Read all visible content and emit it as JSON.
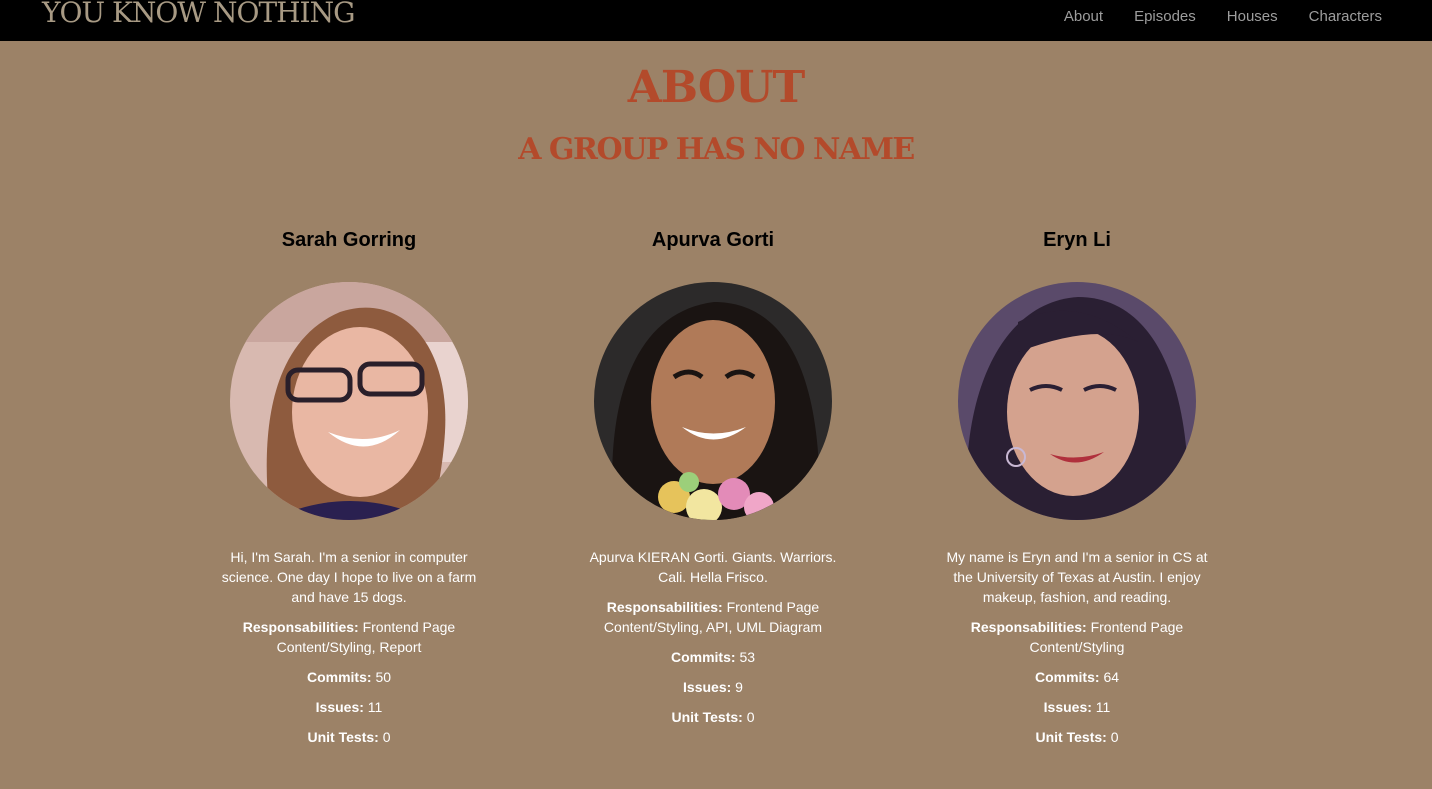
{
  "navbar": {
    "brand": "YOU KNOW NOTHING",
    "links": [
      "About",
      "Episodes",
      "Houses",
      "Characters"
    ]
  },
  "page": {
    "title": "ABOUT",
    "subtitle": "A GROUP HAS NO NAME"
  },
  "labels": {
    "responsibilities": "Responsabilities:",
    "commits": "Commits:",
    "issues": "Issues:",
    "unit_tests": "Unit Tests:"
  },
  "members": [
    {
      "name": "Sarah Gorring",
      "bio": "Hi, I'm Sarah. I'm a senior in computer science. One day I hope to live on a farm and have 15 dogs.",
      "responsibilities": "Frontend Page Content/Styling, Report",
      "commits": "50",
      "issues": "11",
      "unit_tests": "0"
    },
    {
      "name": "Apurva Gorti",
      "bio": "Apurva KIERAN Gorti. Giants. Warriors. Cali. Hella Frisco.",
      "responsibilities": "Frontend Page Content/Styling, API, UML Diagram",
      "commits": "53",
      "issues": "9",
      "unit_tests": "0"
    },
    {
      "name": "Eryn Li",
      "bio": "My name is Eryn and I'm a senior in CS at the University of Texas at Austin. I enjoy makeup, fashion, and reading.",
      "responsibilities": "Frontend Page Content/Styling",
      "commits": "64",
      "issues": "11",
      "unit_tests": "0"
    }
  ],
  "colors": {
    "background": "#9c8267",
    "navbar": "#000000",
    "accent": "#b34a2b"
  }
}
